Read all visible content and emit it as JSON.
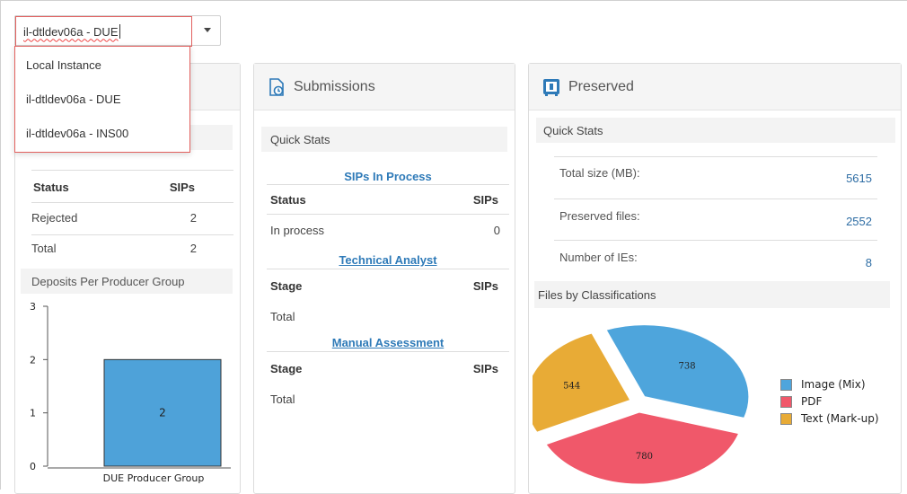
{
  "instance_selector": {
    "value": "il-dtldev06a - DUE",
    "options": [
      "Local Instance",
      "il-dtldev06a - DUE",
      "il-dtldev06a - INS00"
    ]
  },
  "deposits_panel": {
    "status_table": {
      "headers": [
        "Status",
        "SIPs"
      ],
      "rows": [
        {
          "status": "Rejected",
          "sips": "2"
        },
        {
          "status": "Total",
          "sips": "2"
        }
      ]
    },
    "chart_title": "Deposits Per Producer Group"
  },
  "submissions_panel": {
    "title": "Submissions",
    "subbar": "Quick Stats",
    "sips_in_process": {
      "title": "SIPs In Process",
      "headers": [
        "Status",
        "SIPs"
      ],
      "rows": [
        {
          "label": "In process",
          "value": "0"
        }
      ]
    },
    "technical_analyst": {
      "title": "Technical Analyst",
      "headers": [
        "Stage",
        "SIPs"
      ],
      "rows": [
        {
          "label": "Total",
          "value": ""
        }
      ]
    },
    "manual_assessment": {
      "title": "Manual Assessment",
      "headers": [
        "Stage",
        "SIPs"
      ],
      "rows": [
        {
          "label": "Total",
          "value": ""
        }
      ]
    }
  },
  "preserved_panel": {
    "title": "Preserved",
    "subbar": "Quick Stats",
    "stats": [
      {
        "label": "Total size (MB):",
        "value": "5615"
      },
      {
        "label": "Preserved files:",
        "value": "2552"
      },
      {
        "label": "Number of IEs:",
        "value": "8"
      }
    ],
    "classification_title": "Files by Classifications"
  },
  "chart_data": [
    {
      "type": "bar",
      "title": "Deposits Per Producer Group",
      "categories": [
        "DUE Producer Group"
      ],
      "values": [
        2
      ],
      "ylim": [
        0,
        3
      ],
      "yticks": [
        0,
        1,
        2,
        3
      ],
      "color": "#4ea2d9",
      "data_labels": true
    },
    {
      "type": "pie",
      "title": "Files by Classifications",
      "labels": [
        "Image (Mix)",
        "PDF",
        "Text (Mark-up)"
      ],
      "values": [
        738,
        780,
        544
      ],
      "colors": [
        "#4ea5dc",
        "#f0586a",
        "#e8ab36"
      ],
      "legend_position": "right"
    }
  ]
}
